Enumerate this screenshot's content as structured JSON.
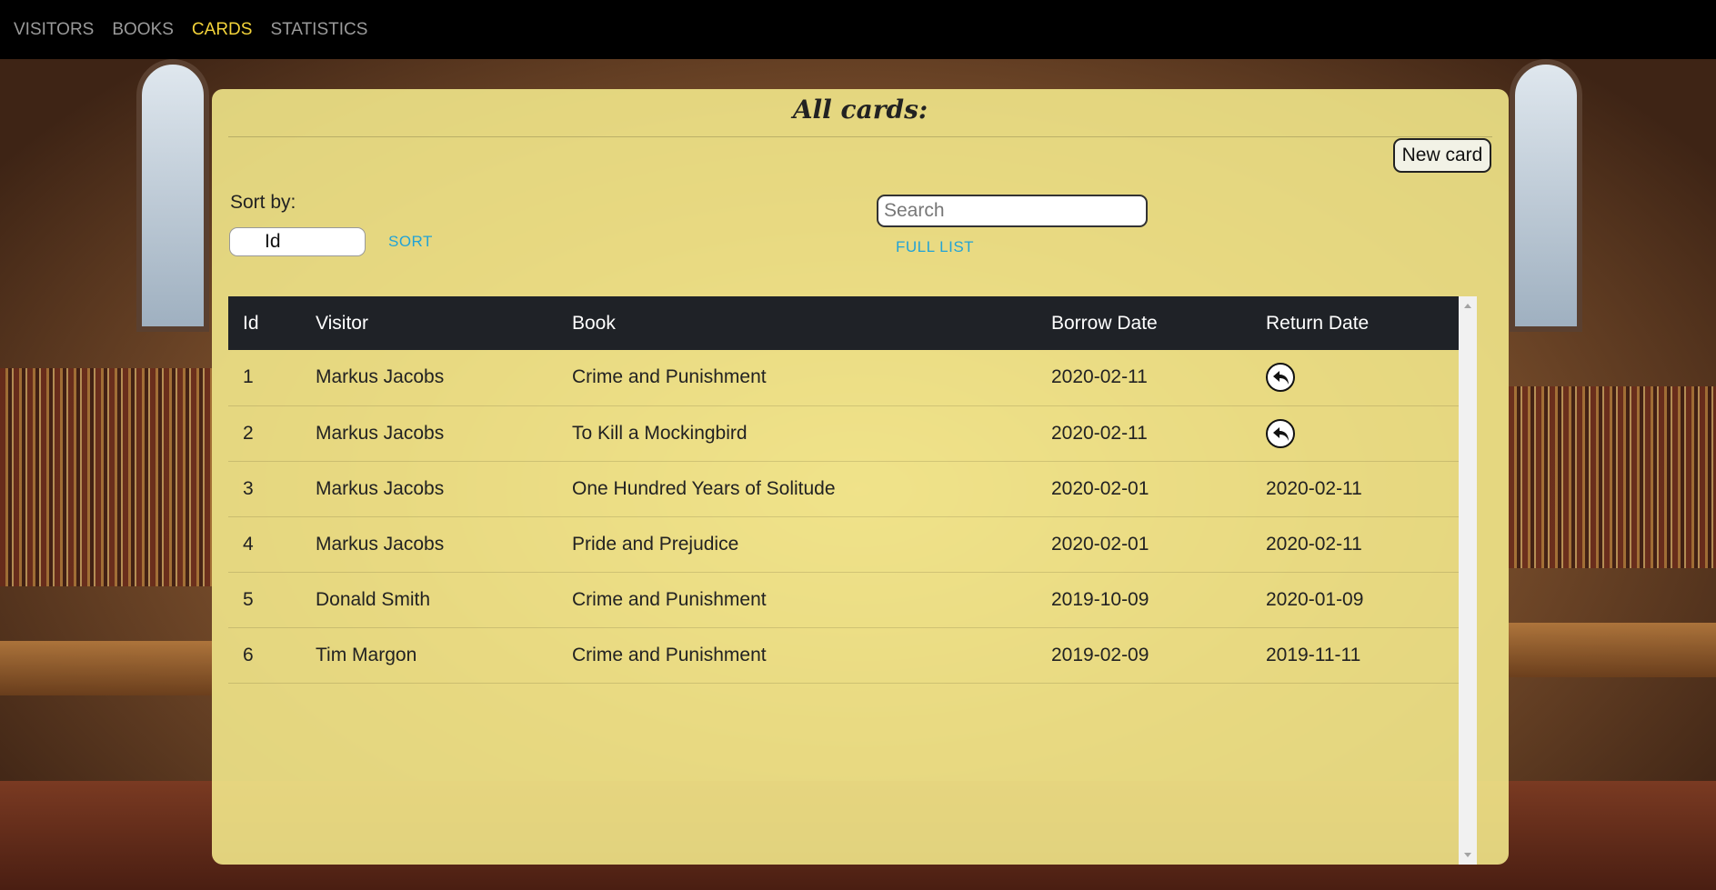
{
  "nav": {
    "items": [
      {
        "label": "VISITORS",
        "active": false
      },
      {
        "label": "BOOKS",
        "active": false
      },
      {
        "label": "CARDS",
        "active": true
      },
      {
        "label": "STATISTICS",
        "active": false
      }
    ]
  },
  "page": {
    "title": "All cards:",
    "new_card_label": "New card"
  },
  "sort": {
    "label": "Sort by:",
    "selected": "Id",
    "button_label": "SORT"
  },
  "search": {
    "placeholder": "Search",
    "value": "",
    "full_list_label": "FULL LIST"
  },
  "table": {
    "headers": [
      "Id",
      "Visitor",
      "Book",
      "Borrow Date",
      "Return Date"
    ],
    "rows": [
      {
        "id": "1",
        "visitor": "Markus Jacobs",
        "book": "Crime and Punishment",
        "borrow_date": "2020-02-11",
        "return_date": null
      },
      {
        "id": "2",
        "visitor": "Markus Jacobs",
        "book": "To Kill a Mockingbird",
        "borrow_date": "2020-02-11",
        "return_date": null
      },
      {
        "id": "3",
        "visitor": "Markus Jacobs",
        "book": "One Hundred Years of Solitude",
        "borrow_date": "2020-02-01",
        "return_date": "2020-02-11"
      },
      {
        "id": "4",
        "visitor": "Markus Jacobs",
        "book": "Pride and Prejudice",
        "borrow_date": "2020-02-01",
        "return_date": "2020-02-11"
      },
      {
        "id": "5",
        "visitor": "Donald Smith",
        "book": "Crime and Punishment",
        "borrow_date": "2019-10-09",
        "return_date": "2020-01-09"
      },
      {
        "id": "6",
        "visitor": "Tim Margon",
        "book": "Crime and Punishment",
        "borrow_date": "2019-02-09",
        "return_date": "2019-11-11"
      }
    ],
    "return_icon": "return-arrow-icon"
  },
  "colors": {
    "nav_bg": "#000000",
    "nav_text": "#9a9a9a",
    "nav_active": "#f3d33a",
    "panel_bg": "#f5eb8c",
    "table_header_bg": "#1f2227",
    "link": "#22a3d6"
  }
}
